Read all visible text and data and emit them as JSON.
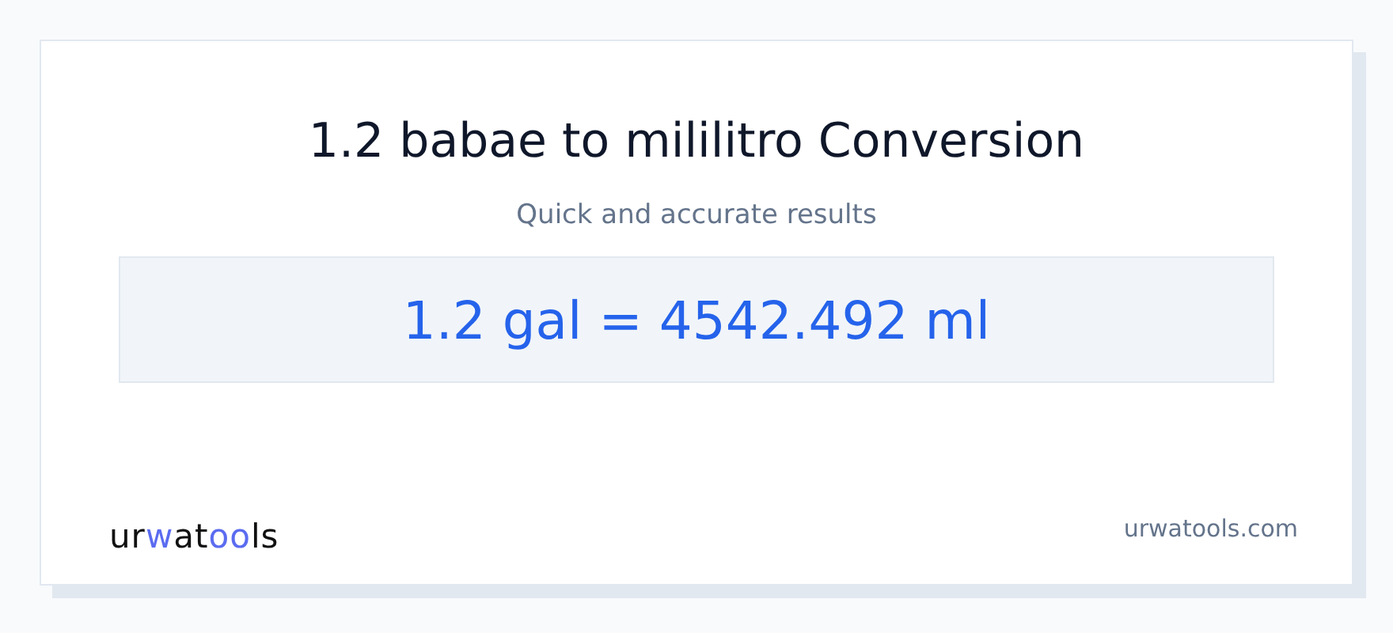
{
  "card": {
    "title": "1.2 babae to mililitro Conversion",
    "subtitle": "Quick and accurate results",
    "result": "1.2 gal = 4542.492 ml"
  },
  "footer": {
    "logo": [
      {
        "text": "ur",
        "accent": false
      },
      {
        "text": "w",
        "accent": true
      },
      {
        "text": "at",
        "accent": false
      },
      {
        "text": "oo",
        "accent": true
      },
      {
        "text": "ls",
        "accent": false
      }
    ],
    "site": "urwatools.com"
  }
}
